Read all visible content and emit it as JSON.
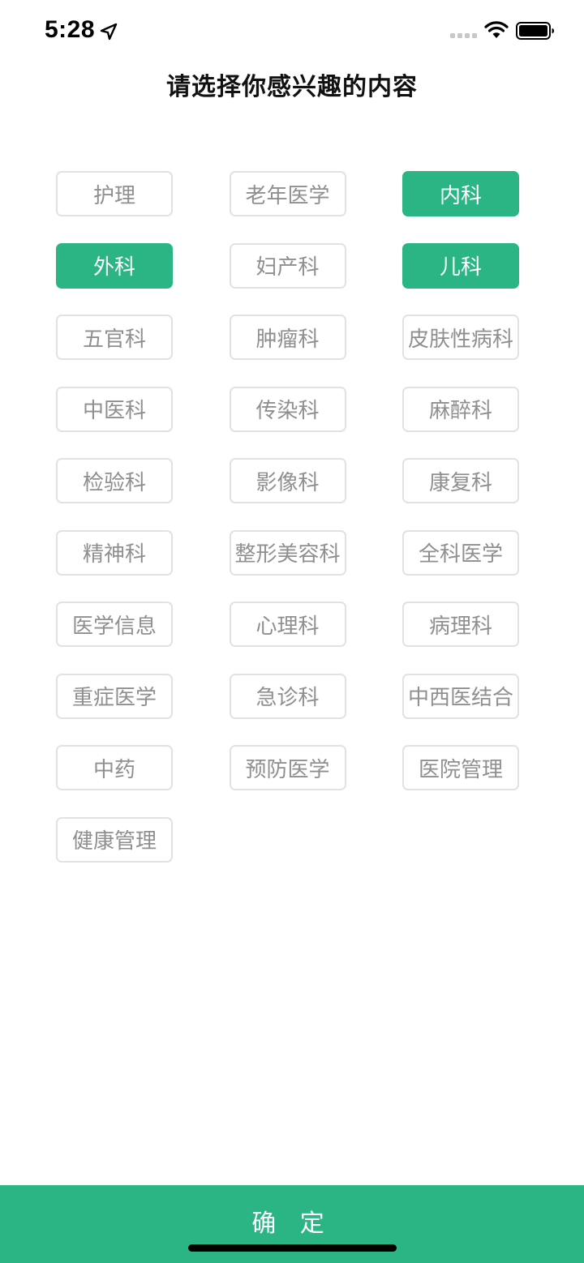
{
  "status_bar": {
    "time": "5:28",
    "icons": [
      "location-arrow-icon",
      "signal-icon",
      "wifi-icon",
      "battery-icon"
    ]
  },
  "title": "请选择你感兴趣的内容",
  "colors": {
    "accent": "#2bb585",
    "tag_border": "#e2e2e2",
    "tag_text": "#8f8f8f",
    "selected_text": "#ffffff"
  },
  "tags": [
    {
      "label": "护理",
      "selected": false
    },
    {
      "label": "老年医学",
      "selected": false
    },
    {
      "label": "内科",
      "selected": true
    },
    {
      "label": "外科",
      "selected": true
    },
    {
      "label": "妇产科",
      "selected": false
    },
    {
      "label": "儿科",
      "selected": true
    },
    {
      "label": "五官科",
      "selected": false
    },
    {
      "label": "肿瘤科",
      "selected": false
    },
    {
      "label": "皮肤性病科",
      "selected": false
    },
    {
      "label": "中医科",
      "selected": false
    },
    {
      "label": "传染科",
      "selected": false
    },
    {
      "label": "麻醉科",
      "selected": false
    },
    {
      "label": "检验科",
      "selected": false
    },
    {
      "label": "影像科",
      "selected": false
    },
    {
      "label": "康复科",
      "selected": false
    },
    {
      "label": "精神科",
      "selected": false
    },
    {
      "label": "整形美容科",
      "selected": false
    },
    {
      "label": "全科医学",
      "selected": false
    },
    {
      "label": "医学信息",
      "selected": false
    },
    {
      "label": "心理科",
      "selected": false
    },
    {
      "label": "病理科",
      "selected": false
    },
    {
      "label": "重症医学",
      "selected": false
    },
    {
      "label": "急诊科",
      "selected": false
    },
    {
      "label": "中西医结合",
      "selected": false
    },
    {
      "label": "中药",
      "selected": false
    },
    {
      "label": "预防医学",
      "selected": false
    },
    {
      "label": "医院管理",
      "selected": false
    },
    {
      "label": "健康管理",
      "selected": false
    }
  ],
  "confirm_label": "确 定"
}
